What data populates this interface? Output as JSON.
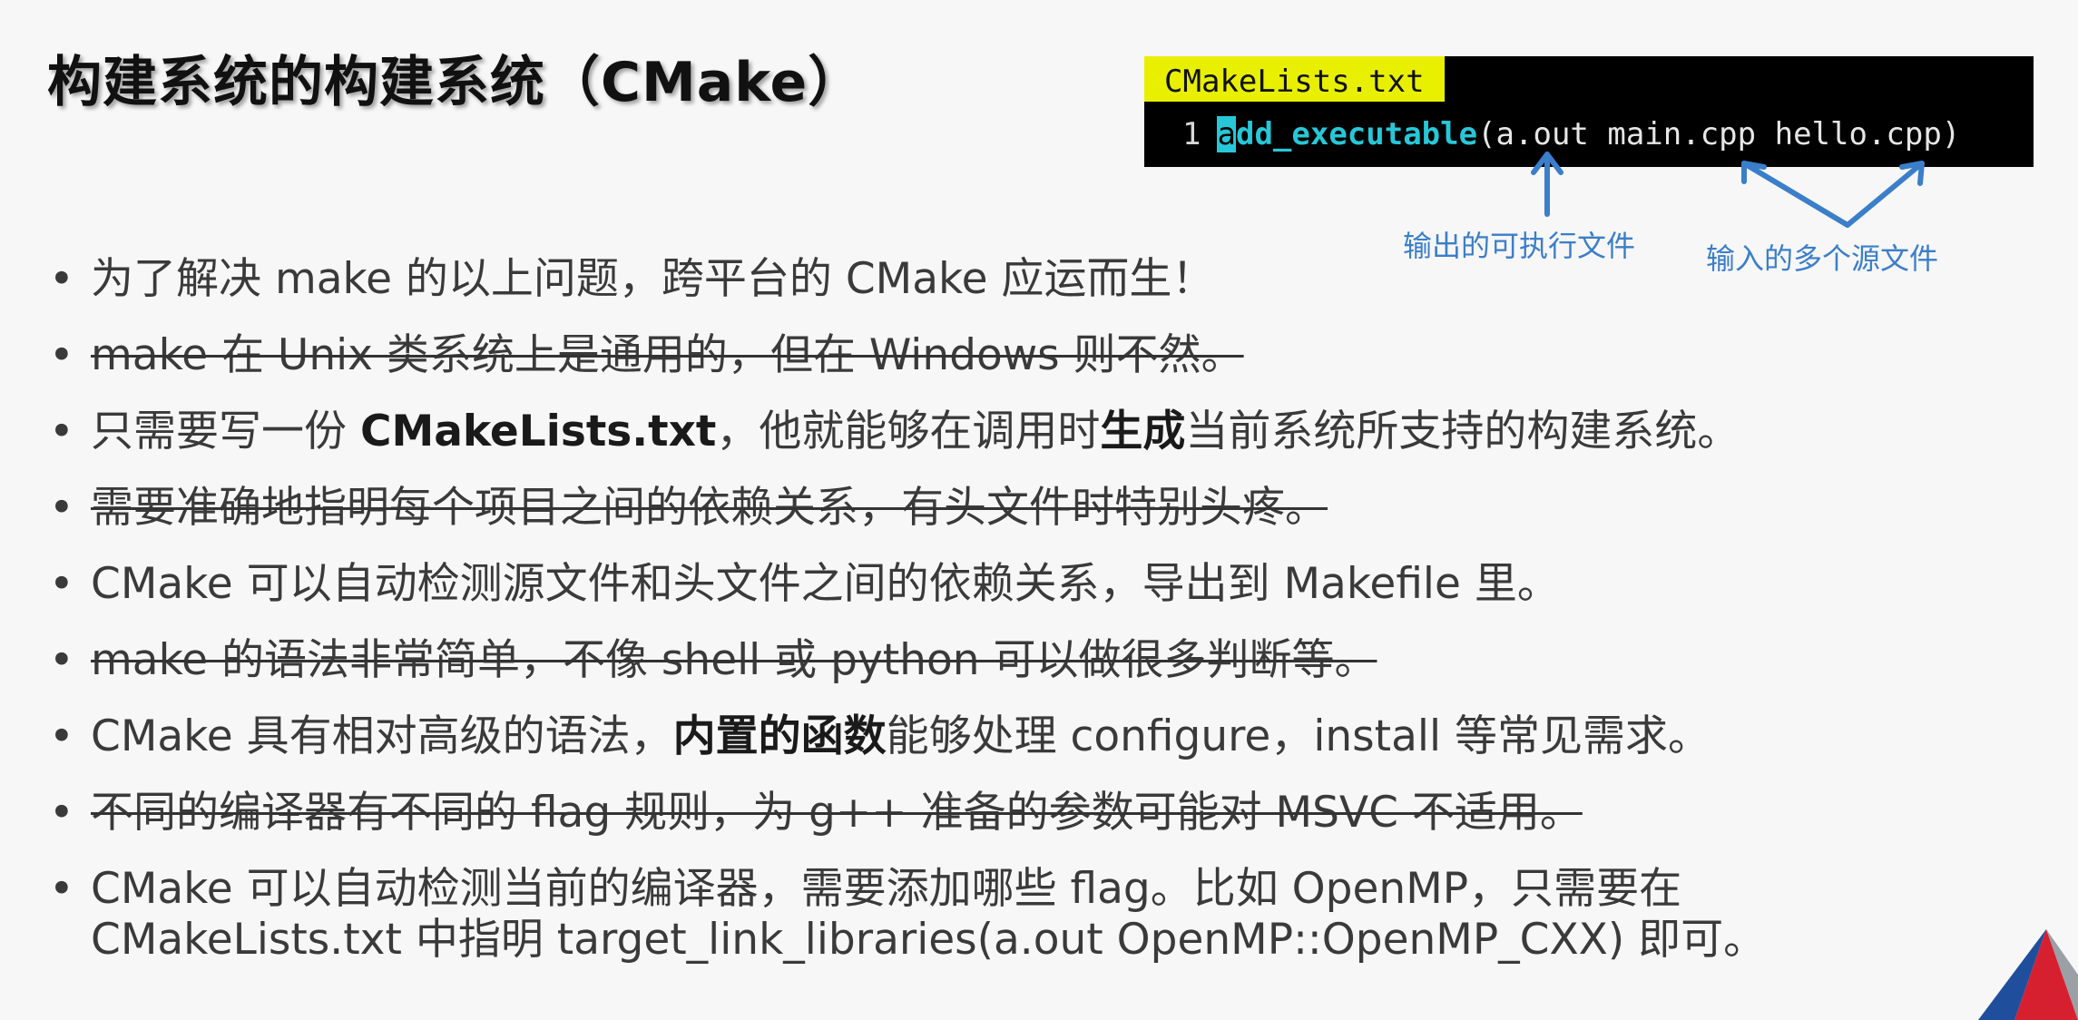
{
  "title": "构建系统的构建系统（CMake）",
  "code": {
    "filename": "CMakeLists.txt",
    "line_number": "1",
    "cursor_char": "a",
    "function_rest": "dd_executable",
    "args": "(a.out main.cpp hello.cpp)"
  },
  "annotations": {
    "output_label": "输出的可执行文件",
    "inputs_label": "输入的多个源文件"
  },
  "bullets": [
    {
      "segments": [
        {
          "text": "为了解决 make 的以上问题，跨平台的 CMake 应运而生！",
          "bold": false
        }
      ],
      "struck": false
    },
    {
      "segments": [
        {
          "text": "make 在 Unix 类系统上是通用的，但在 Windows 则不然。",
          "bold": false
        }
      ],
      "struck": true
    },
    {
      "segments": [
        {
          "text": "只需要写一份 ",
          "bold": false
        },
        {
          "text": "CMakeLists.txt",
          "bold": true
        },
        {
          "text": "，他就能够在调用时",
          "bold": false
        },
        {
          "text": "生成",
          "bold": true
        },
        {
          "text": "当前系统所支持的构建系统。",
          "bold": false
        }
      ],
      "struck": false
    },
    {
      "segments": [
        {
          "text": "需要准确地指明每个项目之间的依赖关系，有头文件时特别头疼。",
          "bold": false
        }
      ],
      "struck": true
    },
    {
      "segments": [
        {
          "text": "CMake 可以自动检测源文件和头文件之间的依赖关系，导出到 Makefile 里。",
          "bold": false
        }
      ],
      "struck": false
    },
    {
      "segments": [
        {
          "text": "make 的语法非常简单，不像 shell 或 python 可以做很多判断等。",
          "bold": false
        }
      ],
      "struck": true
    },
    {
      "segments": [
        {
          "text": "CMake 具有相对高级的语法，",
          "bold": false
        },
        {
          "text": "内置的函数",
          "bold": true
        },
        {
          "text": "能够处理 configure，install 等常见需求。",
          "bold": false
        }
      ],
      "struck": false
    },
    {
      "segments": [
        {
          "text": "不同的编译器有不同的 flag 规则，为 g++ 准备的参数可能对 MSVC 不适用。",
          "bold": false
        }
      ],
      "struck": true
    },
    {
      "segments": [
        {
          "text": "CMake 可以自动检测当前的编译器，需要添加哪些 flag。比如 OpenMP，只需要在",
          "bold": false
        },
        {
          "text": "\nCMakeLists.txt 中指明 target_link_libraries(a.out OpenMP::OpenMP_CXX) 即可。",
          "bold": false
        }
      ],
      "struck": false
    }
  ],
  "colors": {
    "annotation": "#3b7ec9",
    "tab_bg": "#e8f000",
    "function": "#27c7d8",
    "logo_red": "#d7202f",
    "logo_blue": "#1f4e9c"
  }
}
